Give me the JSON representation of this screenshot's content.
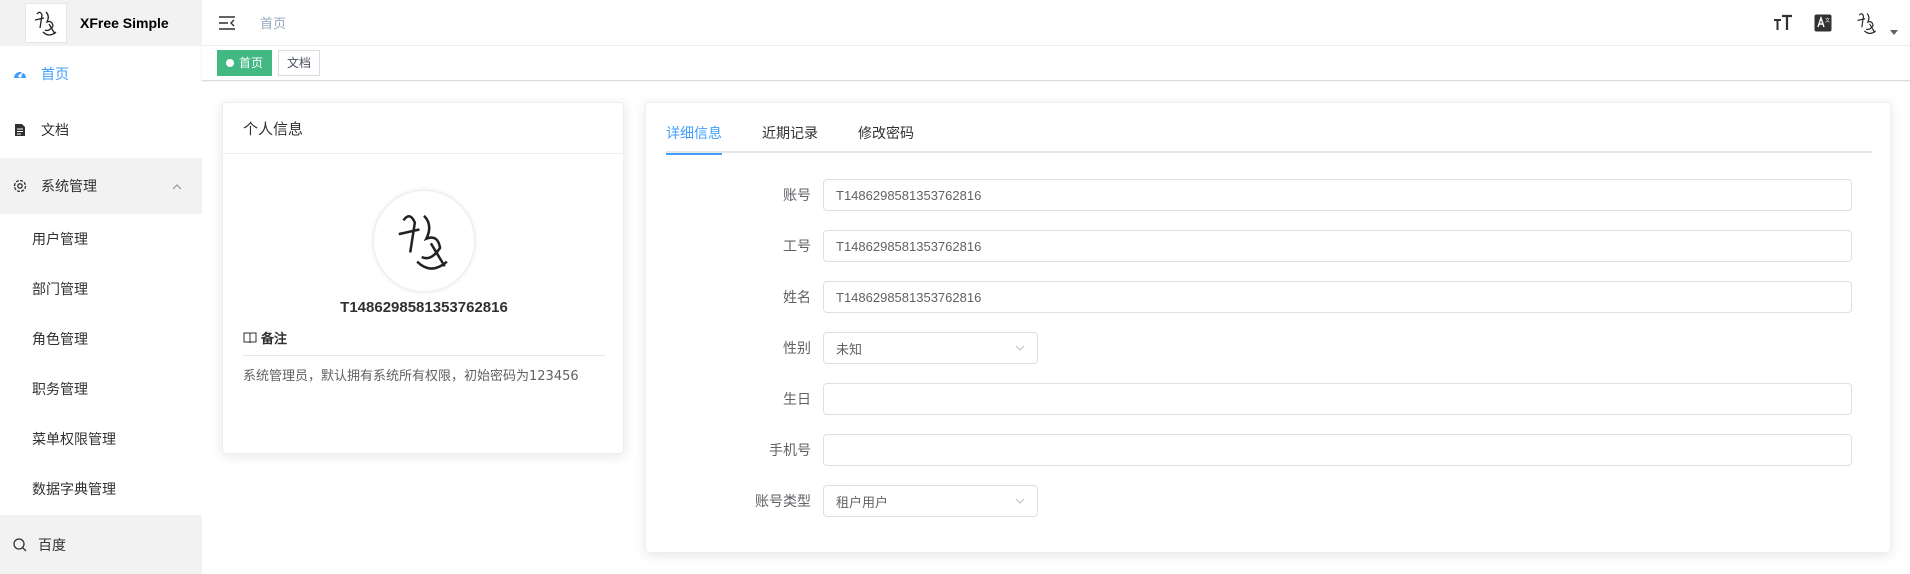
{
  "app": {
    "title": "XFree Simple"
  },
  "sidebar": {
    "items": [
      {
        "label": "首页",
        "icon": "dashboard-icon"
      },
      {
        "label": "文档",
        "icon": "document-icon"
      },
      {
        "label": "系统管理",
        "icon": "gear-icon"
      }
    ],
    "sub_items": [
      "用户管理",
      "部门管理",
      "角色管理",
      "职务管理",
      "菜单权限管理",
      "数据字典管理"
    ],
    "bottom_item": {
      "label": "百度",
      "icon": "search-icon"
    }
  },
  "header": {
    "breadcrumb": "首页",
    "icons": [
      "font-size-icon",
      "translate-icon",
      "user-avatar"
    ]
  },
  "tags": [
    {
      "label": "首页",
      "active": true
    },
    {
      "label": "文档",
      "active": false
    }
  ],
  "profile_card": {
    "title": "个人信息",
    "username": "T1486298581353762816",
    "remark_title": "备注",
    "remark_text": "系统管理员，默认拥有系统所有权限，初始密码为123456"
  },
  "details": {
    "tabs": [
      "详细信息",
      "近期记录",
      "修改密码"
    ],
    "fields": {
      "account": {
        "label": "账号",
        "value": "T1486298581353762816"
      },
      "employee_no": {
        "label": "工号",
        "value": "T1486298581353762816"
      },
      "name": {
        "label": "姓名",
        "value": "T1486298581353762816"
      },
      "gender": {
        "label": "性别",
        "value": "未知"
      },
      "birthday": {
        "label": "生日",
        "value": ""
      },
      "phone": {
        "label": "手机号",
        "value": ""
      },
      "account_type": {
        "label": "账号类型",
        "value": "租户用户"
      }
    }
  },
  "colors": {
    "accent": "#409eff",
    "tag_active": "#42b983"
  }
}
